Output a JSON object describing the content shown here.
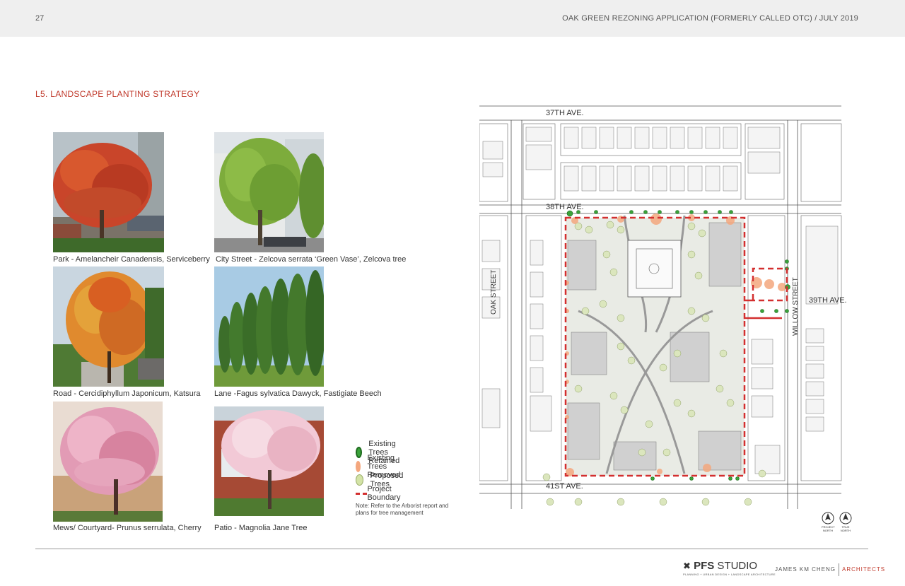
{
  "header": {
    "page_number": "27",
    "document_title": "OAK GREEN REZONING APPLICATION (FORMERLY CALLED OTC)  /  JULY 2019"
  },
  "section_title": "L5.  LANDSCAPE PLANTING STRATEGY",
  "plants": [
    {
      "caption": "Park - Amelancheir Canadensis, Serviceberry"
    },
    {
      "caption": "City Street - Zelcova serrata ‘Green Vase’, Zelcova tree"
    },
    {
      "caption": "Road - Cercidiphyllum Japonicum,  Katsura"
    },
    {
      "caption": "Lane -Fagus sylvatica Dawyck, Fastigiate Beech"
    },
    {
      "caption": "Mews/ Courtyard- Prunus serrulata, Cherry"
    },
    {
      "caption": "Patio - Magnolia Jane Tree"
    }
  ],
  "legend": {
    "items": [
      {
        "label": "Existing Trees Retained",
        "color": "#3aa23a"
      },
      {
        "label": "Existing Trees Removed",
        "color": "#f4a77e"
      },
      {
        "label": "Proposed Trees",
        "color": "#d3e3a6"
      },
      {
        "label": "Project Boundary",
        "color": "#d32f2f"
      }
    ],
    "note": "Note: Refer to the Arborist report and plans for tree management"
  },
  "map": {
    "streets": {
      "s37": "37TH AVE.",
      "s38": "38TH AVE.",
      "s39": "39TH AVE.",
      "s41": "41ST AVE.",
      "oak": "OAK STREET",
      "willow": "WILLOW STREET"
    },
    "north_arrows": [
      "PROJECT NORTH",
      "TRUE NORTH"
    ]
  },
  "footer": {
    "pfs_bold": "PFS",
    "pfs_rest": " STUDIO",
    "pfs_sub": "PLANNING + URBAN DESIGN + LANDSCAPE ARCHITECTURE",
    "jkc_name": "JAMES KM CHENG",
    "jkc_arch": "ARCHITECTS"
  }
}
